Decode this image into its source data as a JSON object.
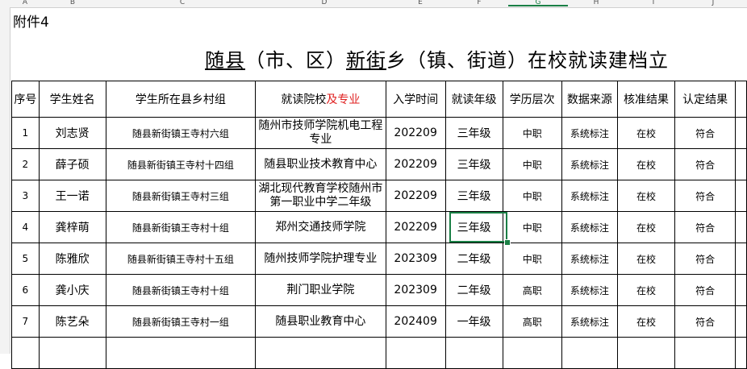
{
  "spreadsheet": {
    "column_headers": [
      "A",
      "B",
      "C",
      "D",
      "E",
      "F",
      "G",
      "H",
      "I",
      "J",
      "K"
    ],
    "active_column": "G",
    "annex_label": "附件4",
    "title": {
      "county": "随县",
      "middle": "（市、区）",
      "town": "新街",
      "rest": "乡（镇、街道）在校就读建档立"
    },
    "table": {
      "headers": [
        {
          "text": "序号"
        },
        {
          "text": "学生姓名"
        },
        {
          "text": "学生所在县乡村组"
        },
        {
          "text": "就读院校",
          "red": "及专业"
        },
        {
          "text": "入学时间"
        },
        {
          "text": "就读年级"
        },
        {
          "text": "学历层次"
        },
        {
          "text": "数据来源"
        },
        {
          "text": "核准结果"
        },
        {
          "text": "认定结果"
        }
      ],
      "rows": [
        {
          "no": "1",
          "name": "刘志贤",
          "village": "随县新街镇王寺村六组",
          "school": "随州市技师学院机电工程专业",
          "enroll": "202209",
          "grade": "三年级",
          "level": "中职",
          "source": "系统标注",
          "verify": "在校",
          "result": "符合"
        },
        {
          "no": "2",
          "name": "薛子硕",
          "village": "随县新街镇王寺村十四组",
          "school": "随县职业技术教育中心",
          "enroll": "202209",
          "grade": "三年级",
          "level": "中职",
          "source": "系统标注",
          "verify": "在校",
          "result": "符合"
        },
        {
          "no": "3",
          "name": "王一诺",
          "village": "随县新街镇王寺村三组",
          "school": "湖北现代教育学校随州市第一职业中学二年级",
          "enroll": "202209",
          "grade": "三年级",
          "level": "中职",
          "source": "系统标注",
          "verify": "在校",
          "result": "符合"
        },
        {
          "no": "4",
          "name": "龚梓萌",
          "village": "随县新街镇王寺村十组",
          "school": "郑州交通技师学院",
          "enroll": "202209",
          "grade": "三年级",
          "level": "中职",
          "source": "系统标注",
          "verify": "在校",
          "result": "符合"
        },
        {
          "no": "5",
          "name": "陈雅欣",
          "village": "随县新街镇王寺村十五组",
          "school": "随州技师学院护理专业",
          "enroll": "202309",
          "grade": "二年级",
          "level": "中职",
          "source": "系统标注",
          "verify": "在校",
          "result": "符合"
        },
        {
          "no": "6",
          "name": "龚小庆",
          "village": "随县新街镇王寺村十组",
          "school": "荆门职业学院",
          "enroll": "202309",
          "grade": "二年级",
          "level": "高职",
          "source": "系统标注",
          "verify": "在校",
          "result": "符合"
        },
        {
          "no": "7",
          "name": "陈艺朵",
          "village": "随县新街镇王寺村一组",
          "school": "随县职业教育中心",
          "enroll": "202409",
          "grade": "一年级",
          "level": "高职",
          "source": "系统标注",
          "verify": "在校",
          "result": "符合"
        }
      ]
    }
  }
}
